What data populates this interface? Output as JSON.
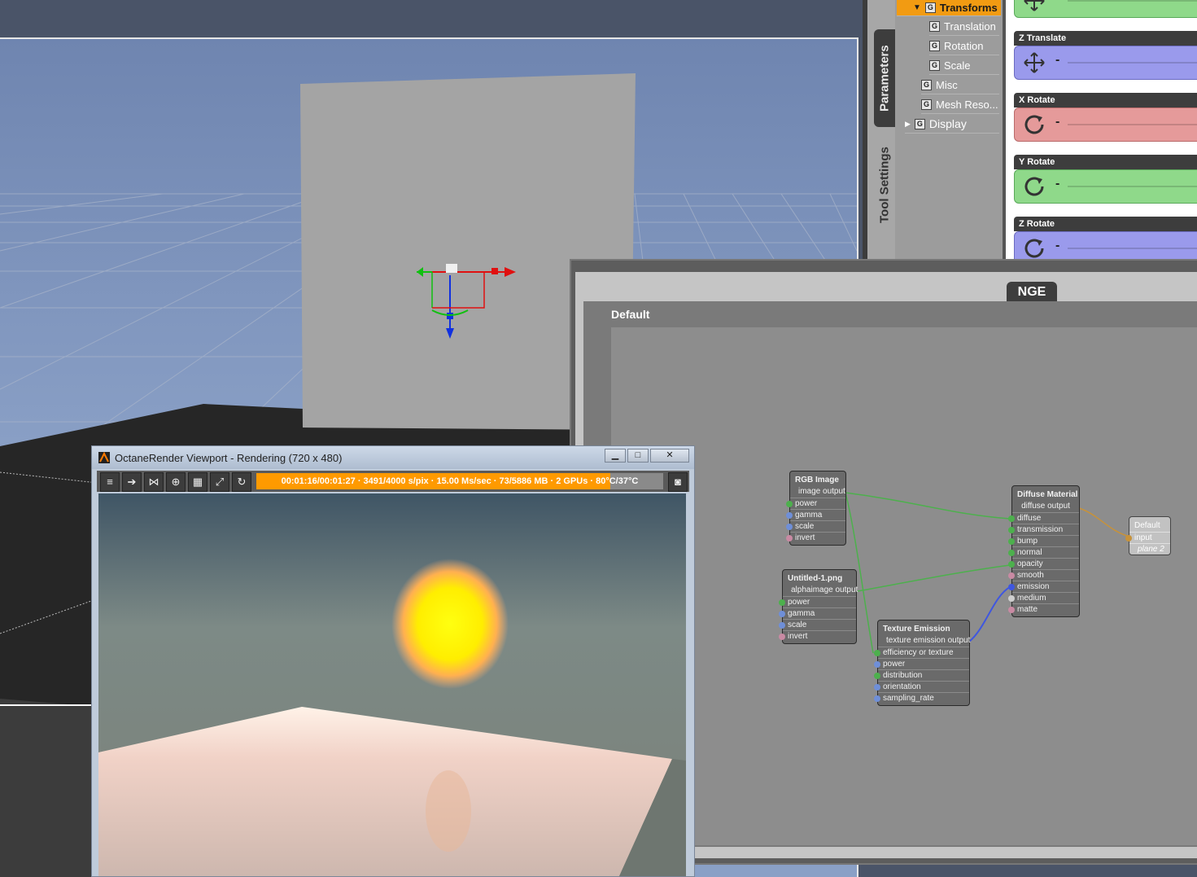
{
  "params": {
    "tabs": {
      "parameters": "Parameters",
      "tool_settings": "Tool Settings"
    },
    "tree": {
      "transforms": "Transforms",
      "translation": "Translation",
      "rotation": "Rotation",
      "scale": "Scale",
      "misc": "Misc",
      "mesh_reso": "Mesh Reso...",
      "display": "Display",
      "group_glyph": "G"
    },
    "dials": [
      {
        "label": "",
        "value": "-",
        "icon": "move-icon",
        "color": "#8fd98a"
      },
      {
        "label": "Z Translate",
        "value": "-",
        "icon": "move-icon",
        "color": "#9a9aec"
      },
      {
        "label": "X Rotate",
        "value": "-",
        "icon": "rotate-icon",
        "color": "#e59a9a"
      },
      {
        "label": "Y Rotate",
        "value": "-",
        "icon": "rotate-icon",
        "color": "#8fd98a"
      },
      {
        "label": "Z Rotate",
        "value": "-",
        "icon": "rotate-icon",
        "color": "#9a9aec"
      }
    ]
  },
  "nge": {
    "tab": "NGE",
    "graph_name": "Default",
    "nodes": {
      "rgb": {
        "title": "RGB Image",
        "output": "image output",
        "inputs": [
          "power",
          "gamma",
          "scale",
          "invert"
        ]
      },
      "untitled": {
        "title": "Untitled-1.png",
        "output": "alphaimage output",
        "inputs": [
          "power",
          "gamma",
          "scale",
          "invert"
        ]
      },
      "texture": {
        "title": "Texture Emission",
        "output": "texture emission output",
        "inputs": [
          "efficiency or texture",
          "power",
          "distribution",
          "orientation",
          "sampling_rate"
        ]
      },
      "diffuse": {
        "title": "Diffuse Material",
        "output": "diffuse output",
        "inputs": [
          "diffuse",
          "transmission",
          "bump",
          "normal",
          "opacity",
          "smooth",
          "emission",
          "medium",
          "matte"
        ]
      },
      "default": {
        "title": "Default",
        "inputs": [
          "input",
          "plane 2"
        ]
      }
    }
  },
  "octane": {
    "title": "OctaneRender Viewport - Rendering (720 x 480)",
    "status": "00:01:16/00:01:27 · 3491/4000 s/pix · 15.00 Ms/sec · 73/5886 MB · 2 GPUs · 80°C/37°C",
    "progress": 0.87,
    "window_buttons": [
      "▁",
      "□",
      "✕"
    ],
    "toolbar": [
      "menu-icon",
      "import-icon",
      "share-icon",
      "target-icon",
      "grid-icon",
      "fullscreen-icon",
      "refresh-icon"
    ]
  }
}
